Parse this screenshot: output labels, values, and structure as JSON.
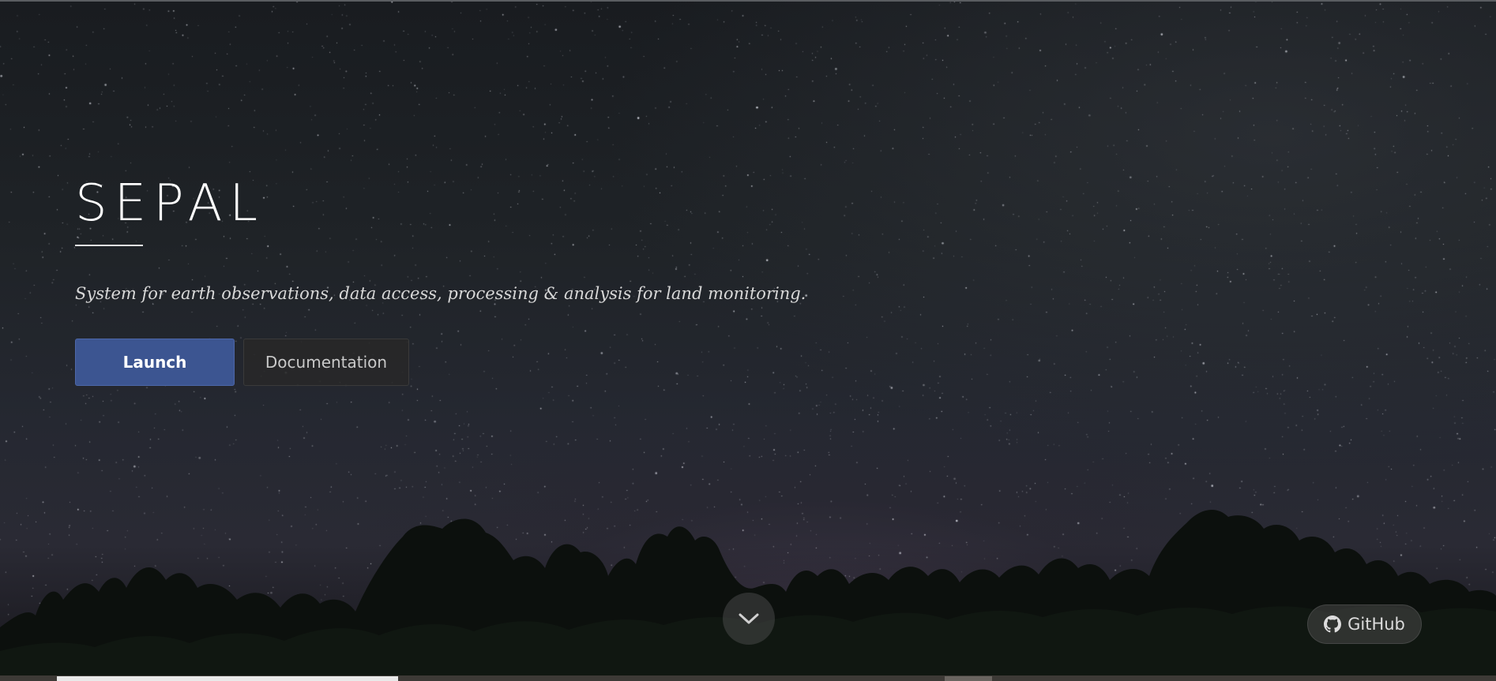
{
  "hero": {
    "title": "SEPAL",
    "tagline": "System for earth observations, data access, processing & analysis for land monitoring."
  },
  "buttons": {
    "launch_label": "Launch",
    "documentation_label": "Documentation"
  },
  "scroll": {
    "icon": "chevron-down-icon"
  },
  "github": {
    "label": "GitHub",
    "icon": "github-icon"
  },
  "colors": {
    "launch_button": "#3c5591",
    "documentation_button": "#282828",
    "sky": "#1f2327"
  }
}
